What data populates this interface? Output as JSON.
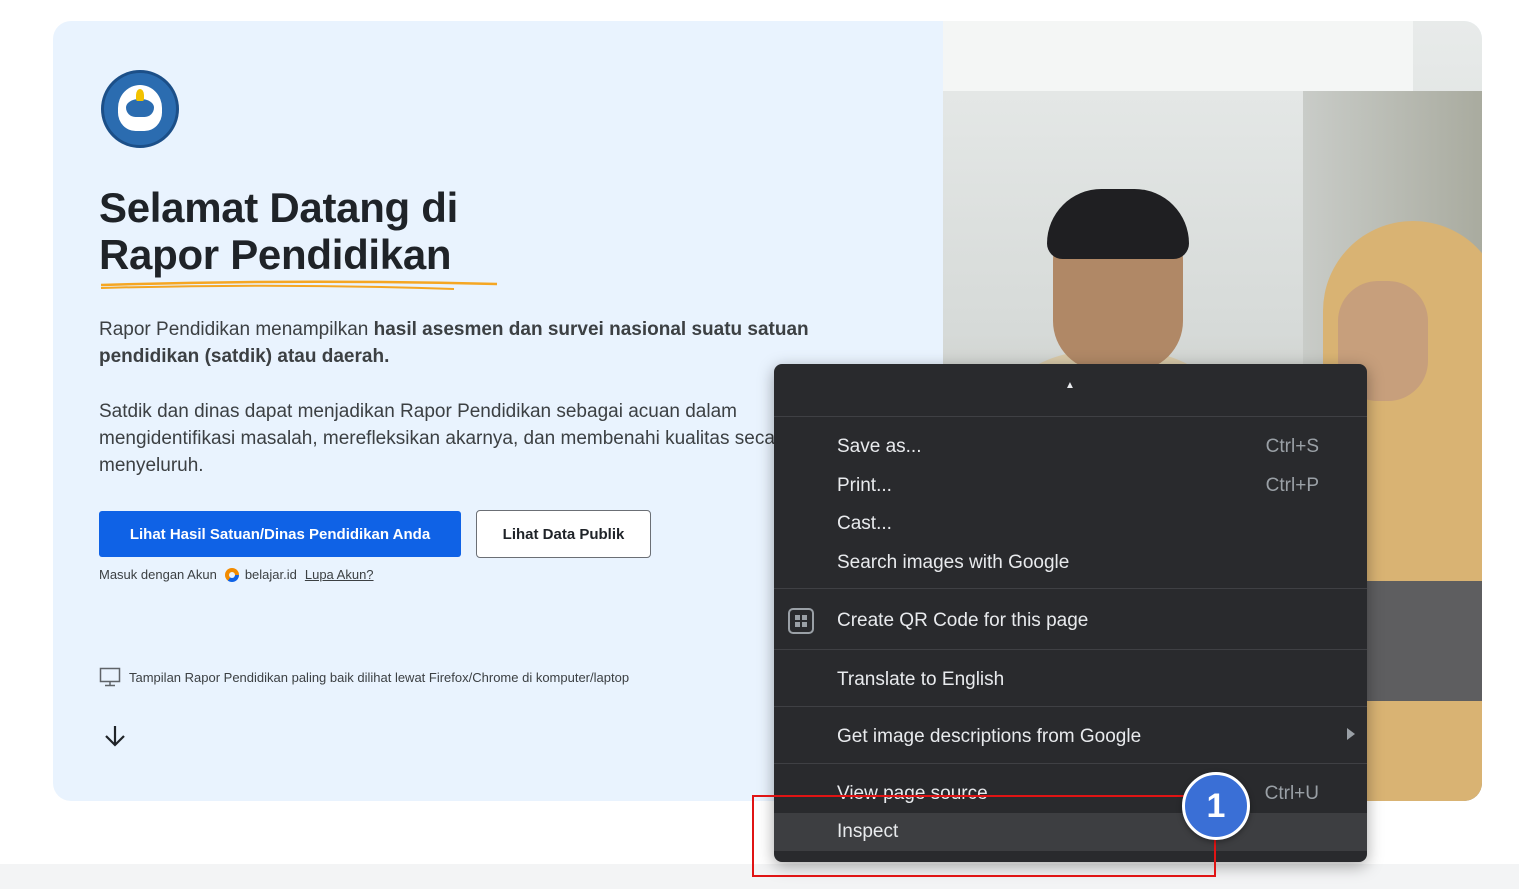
{
  "hero": {
    "title_line1": "Selamat Datang di",
    "title_line2": "Rapor Pendidikan",
    "para1_normal": "Rapor Pendidikan menampilkan ",
    "para1_bold": "hasil asesmen dan survei nasional suatu satuan pendidikan (satdik) atau daerah.",
    "para2": "Satdik dan dinas dapat menjadikan Rapor Pendidikan sebagai acuan dalam mengidentifikasi masalah, merefleksikan akarnya, dan membenahi kualitas secara menyeluruh.",
    "primary_button": "Lihat Hasil Satuan/Dinas Pendidikan Anda",
    "secondary_button": "Lihat Data Publik",
    "login_prefix": "Masuk dengan Akun",
    "login_service": "belajar.id",
    "forgot_link": "Lupa Akun?",
    "tip": "Tampilan Rapor Pendidikan paling baik dilihat lewat Firefox/Chrome di komputer/laptop",
    "accent_color": "#0f62e6",
    "underline_color": "#f5a623"
  },
  "context_menu": {
    "items": [
      {
        "label": "Save as...",
        "shortcut": "Ctrl+S"
      },
      {
        "label": "Print...",
        "shortcut": "Ctrl+P"
      },
      {
        "label": "Cast..."
      },
      {
        "label": "Search images with Google"
      },
      {
        "label": "Create QR Code for this page",
        "icon": "qr-code-icon"
      },
      {
        "label": "Translate to English"
      },
      {
        "label": "Get image descriptions from Google",
        "submenu": true
      },
      {
        "label": "View page source",
        "shortcut": "Ctrl+U"
      },
      {
        "label": "Inspect",
        "highlighted": true
      }
    ]
  },
  "annotation": {
    "step_number": "1",
    "highlight_color": "#e01414",
    "badge_color": "#3a6fd6"
  }
}
